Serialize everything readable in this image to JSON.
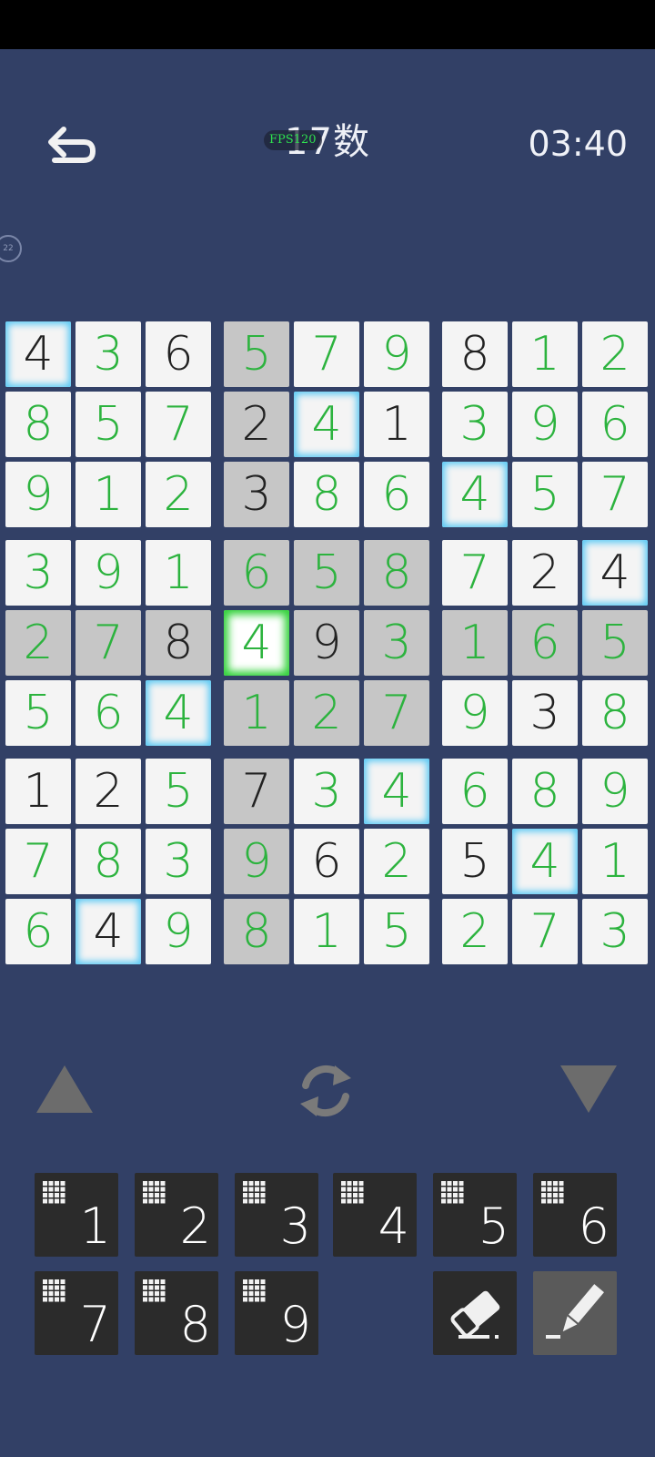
{
  "header": {
    "title": "17数",
    "fps_overlay": "FPS120",
    "timer": "03:40",
    "side_badge": "22"
  },
  "icons": {
    "back": "undo-arrow-icon",
    "previous": "triangle-up-icon",
    "refresh": "refresh-icon",
    "next": "triangle-down-icon",
    "eraser": "eraser-icon",
    "pencil": "pencil-icon",
    "notes": "grid-dots-icon"
  },
  "colors": {
    "background": "#324066",
    "given_digit": "#222222",
    "entered_digit": "#2cb33e",
    "cell": "#f4f4f4",
    "highlight": "#c6c6c6",
    "same_number_glow": "#58c8f4",
    "selected_glow": "#32d23a",
    "key": "#2b2b2b",
    "pencil_active": "#5a5a5a"
  },
  "board": {
    "rows": [
      [
        {
          "v": "4",
          "g": true,
          "hl": false,
          "b": true
        },
        {
          "v": "3",
          "g": false,
          "hl": false,
          "b": false
        },
        {
          "v": "6",
          "g": true,
          "hl": false,
          "b": false
        },
        {
          "v": "5",
          "g": false,
          "hl": true,
          "b": false
        },
        {
          "v": "7",
          "g": false,
          "hl": false,
          "b": false
        },
        {
          "v": "9",
          "g": false,
          "hl": false,
          "b": false
        },
        {
          "v": "8",
          "g": true,
          "hl": false,
          "b": false
        },
        {
          "v": "1",
          "g": false,
          "hl": false,
          "b": false
        },
        {
          "v": "2",
          "g": false,
          "hl": false,
          "b": false
        }
      ],
      [
        {
          "v": "8",
          "g": false,
          "hl": false,
          "b": false
        },
        {
          "v": "5",
          "g": false,
          "hl": false,
          "b": false
        },
        {
          "v": "7",
          "g": false,
          "hl": false,
          "b": false
        },
        {
          "v": "2",
          "g": true,
          "hl": true,
          "b": false
        },
        {
          "v": "4",
          "g": false,
          "hl": false,
          "b": true
        },
        {
          "v": "1",
          "g": true,
          "hl": false,
          "b": false
        },
        {
          "v": "3",
          "g": false,
          "hl": false,
          "b": false
        },
        {
          "v": "9",
          "g": false,
          "hl": false,
          "b": false
        },
        {
          "v": "6",
          "g": false,
          "hl": false,
          "b": false
        }
      ],
      [
        {
          "v": "9",
          "g": false,
          "hl": false,
          "b": false
        },
        {
          "v": "1",
          "g": false,
          "hl": false,
          "b": false
        },
        {
          "v": "2",
          "g": false,
          "hl": false,
          "b": false
        },
        {
          "v": "3",
          "g": true,
          "hl": true,
          "b": false
        },
        {
          "v": "8",
          "g": false,
          "hl": false,
          "b": false
        },
        {
          "v": "6",
          "g": false,
          "hl": false,
          "b": false
        },
        {
          "v": "4",
          "g": false,
          "hl": false,
          "b": true
        },
        {
          "v": "5",
          "g": false,
          "hl": false,
          "b": false
        },
        {
          "v": "7",
          "g": false,
          "hl": false,
          "b": false
        }
      ],
      [
        {
          "v": "3",
          "g": false,
          "hl": false,
          "b": false
        },
        {
          "v": "9",
          "g": false,
          "hl": false,
          "b": false
        },
        {
          "v": "1",
          "g": false,
          "hl": false,
          "b": false
        },
        {
          "v": "6",
          "g": false,
          "hl": true,
          "b": false
        },
        {
          "v": "5",
          "g": false,
          "hl": true,
          "b": false
        },
        {
          "v": "8",
          "g": false,
          "hl": true,
          "b": false
        },
        {
          "v": "7",
          "g": false,
          "hl": false,
          "b": false
        },
        {
          "v": "2",
          "g": true,
          "hl": false,
          "b": false
        },
        {
          "v": "4",
          "g": true,
          "hl": false,
          "b": true
        }
      ],
      [
        {
          "v": "2",
          "g": false,
          "hl": true,
          "b": false
        },
        {
          "v": "7",
          "g": false,
          "hl": true,
          "b": false
        },
        {
          "v": "8",
          "g": true,
          "hl": true,
          "b": false
        },
        {
          "v": "4",
          "g": false,
          "hl": false,
          "b": false,
          "sel": true
        },
        {
          "v": "9",
          "g": true,
          "hl": true,
          "b": false
        },
        {
          "v": "3",
          "g": false,
          "hl": true,
          "b": false
        },
        {
          "v": "1",
          "g": false,
          "hl": true,
          "b": false
        },
        {
          "v": "6",
          "g": false,
          "hl": true,
          "b": false
        },
        {
          "v": "5",
          "g": false,
          "hl": true,
          "b": false
        }
      ],
      [
        {
          "v": "5",
          "g": false,
          "hl": false,
          "b": false
        },
        {
          "v": "6",
          "g": false,
          "hl": false,
          "b": false
        },
        {
          "v": "4",
          "g": false,
          "hl": false,
          "b": true
        },
        {
          "v": "1",
          "g": false,
          "hl": true,
          "b": false
        },
        {
          "v": "2",
          "g": false,
          "hl": true,
          "b": false
        },
        {
          "v": "7",
          "g": false,
          "hl": true,
          "b": false
        },
        {
          "v": "9",
          "g": false,
          "hl": false,
          "b": false
        },
        {
          "v": "3",
          "g": true,
          "hl": false,
          "b": false
        },
        {
          "v": "8",
          "g": false,
          "hl": false,
          "b": false
        }
      ],
      [
        {
          "v": "1",
          "g": true,
          "hl": false,
          "b": false
        },
        {
          "v": "2",
          "g": true,
          "hl": false,
          "b": false
        },
        {
          "v": "5",
          "g": false,
          "hl": false,
          "b": false
        },
        {
          "v": "7",
          "g": true,
          "hl": true,
          "b": false
        },
        {
          "v": "3",
          "g": false,
          "hl": false,
          "b": false
        },
        {
          "v": "4",
          "g": false,
          "hl": false,
          "b": true
        },
        {
          "v": "6",
          "g": false,
          "hl": false,
          "b": false
        },
        {
          "v": "8",
          "g": false,
          "hl": false,
          "b": false
        },
        {
          "v": "9",
          "g": false,
          "hl": false,
          "b": false
        }
      ],
      [
        {
          "v": "7",
          "g": false,
          "hl": false,
          "b": false
        },
        {
          "v": "8",
          "g": false,
          "hl": false,
          "b": false
        },
        {
          "v": "3",
          "g": false,
          "hl": false,
          "b": false
        },
        {
          "v": "9",
          "g": false,
          "hl": true,
          "b": false
        },
        {
          "v": "6",
          "g": true,
          "hl": false,
          "b": false
        },
        {
          "v": "2",
          "g": false,
          "hl": false,
          "b": false
        },
        {
          "v": "5",
          "g": true,
          "hl": false,
          "b": false
        },
        {
          "v": "4",
          "g": false,
          "hl": false,
          "b": true
        },
        {
          "v": "1",
          "g": false,
          "hl": false,
          "b": false
        }
      ],
      [
        {
          "v": "6",
          "g": false,
          "hl": false,
          "b": false
        },
        {
          "v": "4",
          "g": true,
          "hl": false,
          "b": true
        },
        {
          "v": "9",
          "g": false,
          "hl": false,
          "b": false
        },
        {
          "v": "8",
          "g": false,
          "hl": true,
          "b": false
        },
        {
          "v": "1",
          "g": false,
          "hl": false,
          "b": false
        },
        {
          "v": "5",
          "g": false,
          "hl": false,
          "b": false
        },
        {
          "v": "2",
          "g": false,
          "hl": false,
          "b": false
        },
        {
          "v": "7",
          "g": false,
          "hl": false,
          "b": false
        },
        {
          "v": "3",
          "g": false,
          "hl": false,
          "b": false
        }
      ]
    ]
  },
  "number_pad": {
    "keys": [
      "1",
      "2",
      "3",
      "4",
      "5",
      "6",
      "7",
      "8",
      "9"
    ]
  },
  "tools": {
    "eraser_active": false,
    "pencil_active": true
  }
}
